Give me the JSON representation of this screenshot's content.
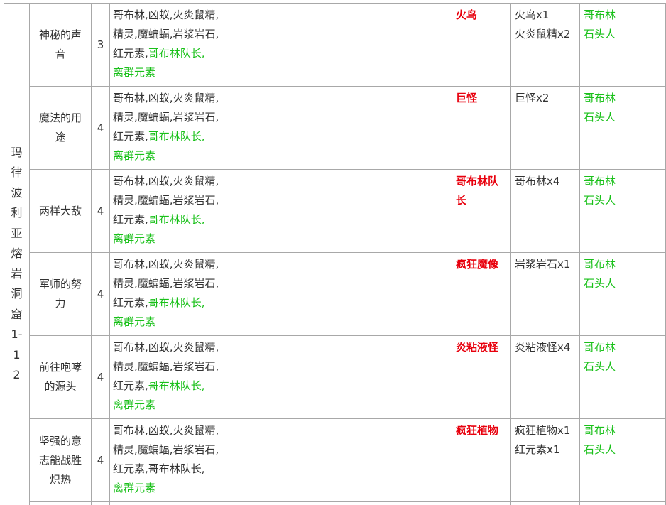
{
  "region": "玛律波利亚熔岩洞窟1-12",
  "colors": {
    "boss": "#e8000d",
    "green": "#19c019",
    "text": "#333333",
    "border": "#a8a8a8"
  },
  "rows": [
    {
      "name": "神秘的声音",
      "count": "3",
      "monsters_line1": "哥布林,凶蚁,火炎鼠精,",
      "monsters_line2": "精灵,魔蝙蝠,岩浆岩石,",
      "monsters_line3_plain": "红元素,",
      "monsters_line3_green": "哥布林队长,",
      "monsters_line4": "离群元素",
      "boss": "火鸟",
      "targets": [
        "火鸟x1",
        "火炎鼠精x2"
      ],
      "rewards": [
        "哥布林",
        "石头人"
      ]
    },
    {
      "name": "魔法的用途",
      "count": "4",
      "monsters_line1": "哥布林,凶蚁,火炎鼠精,",
      "monsters_line2": "精灵,魔蝙蝠,岩浆岩石,",
      "monsters_line3_plain": "红元素,",
      "monsters_line3_green": "哥布林队长,",
      "monsters_line4": "离群元素",
      "boss": "巨怪",
      "targets": [
        "巨怪x2"
      ],
      "rewards": [
        "哥布林",
        "石头人"
      ]
    },
    {
      "name": "两样大敌",
      "count": "4",
      "monsters_line1": "哥布林,凶蚁,火炎鼠精,",
      "monsters_line2": "精灵,魔蝙蝠,岩浆岩石,",
      "monsters_line3_plain": "红元素,",
      "monsters_line3_green": "哥布林队长,",
      "monsters_line4": "离群元素",
      "boss": "哥布林队长",
      "targets": [
        "哥布林x4"
      ],
      "rewards": [
        "哥布林",
        "石头人"
      ]
    },
    {
      "name": "军师的努力",
      "count": "4",
      "monsters_line1": "哥布林,凶蚁,火炎鼠精,",
      "monsters_line2": "精灵,魔蝙蝠,岩浆岩石,",
      "monsters_line3_plain": "红元素,",
      "monsters_line3_green": "哥布林队长,",
      "monsters_line4": "离群元素",
      "boss": "疯狂魔像",
      "targets": [
        "岩浆岩石x1"
      ],
      "rewards": [
        "哥布林",
        "石头人"
      ]
    },
    {
      "name": "前往咆哮的源头",
      "count": "4",
      "monsters_line1": "哥布林,凶蚁,火炎鼠精,",
      "monsters_line2": "精灵,魔蝙蝠,岩浆岩石,",
      "monsters_line3_plain": "红元素,",
      "monsters_line3_green": "哥布林队长,",
      "monsters_line4": "离群元素",
      "boss": "炎粘液怪",
      "targets": [
        "炎粘液怪x4"
      ],
      "rewards": [
        "哥布林",
        "石头人"
      ]
    },
    {
      "name": "坚强的意志能战胜炽热",
      "count": "4",
      "monsters_line1": "哥布林,凶蚁,火炎鼠精,",
      "monsters_line2": "精灵,魔蝙蝠,岩浆岩石,",
      "monsters_line3_plain": "红元素,哥布林队长,",
      "monsters_line3_green": "",
      "monsters_line4": "离群元素",
      "boss": "疯狂植物",
      "targets": [
        "疯狂植物x1",
        "红元素x1"
      ],
      "rewards": [
        "哥布林",
        "石头人"
      ]
    }
  ]
}
